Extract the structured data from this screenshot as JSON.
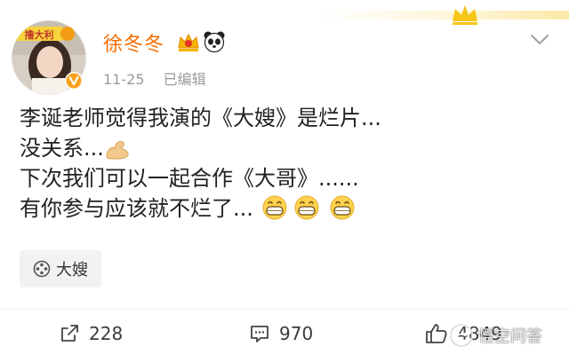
{
  "user": {
    "name": "徐冬冬",
    "avatar_sticker_text": "撸大利",
    "vip_badge_icon": "vip-crown-icon",
    "badge_icon": "panda-icon",
    "verified_icon": "verified-v-icon"
  },
  "meta": {
    "date": "11-25",
    "edited": "已编辑"
  },
  "post": {
    "lines": [
      "李诞老师觉得我演的《大嫂》是烂片...",
      "没关系...",
      "下次我们可以一起合作《大哥》......",
      "有你参与应该就不烂了..."
    ],
    "emoji": {
      "line2": "flexed-biceps-emoji",
      "line4": [
        "grin-emoji",
        "grin-emoji",
        "grin-emoji"
      ]
    }
  },
  "topic": {
    "label": "大嫂",
    "icon": "film-reel-icon"
  },
  "actions": {
    "repost": {
      "count": "228",
      "icon": "repost-icon"
    },
    "comment": {
      "count": "970",
      "icon": "comment-icon"
    },
    "like": {
      "count": "4849",
      "icon": "thumbs-up-icon"
    }
  },
  "watermark": {
    "text": "悟空问答",
    "icon": "wukong-logo-icon"
  },
  "colors": {
    "username": "#f86d00",
    "meta": "#9a9a9a",
    "text": "#222222",
    "chip_bg": "#f2f2f2"
  }
}
